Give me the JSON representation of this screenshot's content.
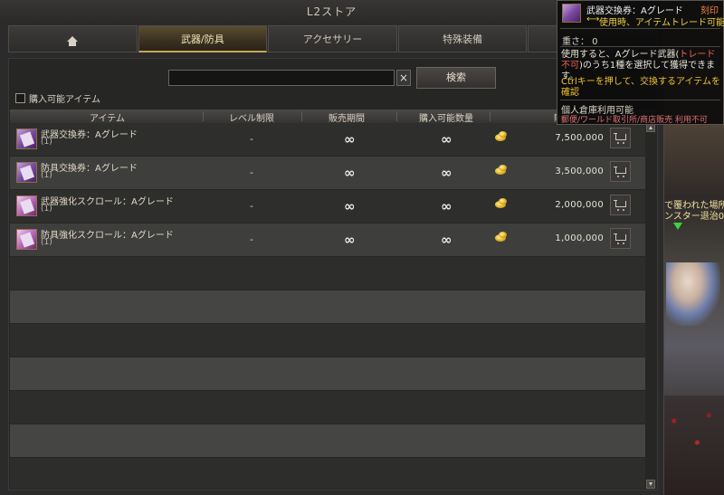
{
  "window": {
    "title": "L2ストア"
  },
  "tabs": [
    {
      "label": "",
      "icon": "home-icon"
    },
    {
      "label": "武器/防具"
    },
    {
      "label": "アクセサリー"
    },
    {
      "label": "特殊装備"
    },
    {
      "label": ""
    }
  ],
  "search": {
    "value": "",
    "placeholder": "",
    "clear_label": "×",
    "button_label": "検索"
  },
  "filter": {
    "purchasable_label": "購入可能アイテム",
    "checked": false
  },
  "columns": {
    "item": "アイテム",
    "level_limit": "レベル制限",
    "sale_period": "販売期間",
    "purchasable_qty": "購入可能数量",
    "price": "販"
  },
  "rows": [
    {
      "name": "武器交換券：Aグレード",
      "qty": "(1)",
      "level": "-",
      "period": "∞",
      "limit": "∞",
      "price": "7,500,000",
      "icon": "weapon-ticket-icon"
    },
    {
      "name": "防具交換券：Aグレード",
      "qty": "(1)",
      "level": "-",
      "period": "∞",
      "limit": "∞",
      "price": "3,500,000",
      "icon": "armor-ticket-icon"
    },
    {
      "name": "武器強化スクロール：Aグレード",
      "qty": "(1)",
      "level": "-",
      "period": "∞",
      "limit": "∞",
      "price": "2,000,000",
      "icon": "weapon-scroll-icon"
    },
    {
      "name": "防具強化スクロール：Aグレード",
      "qty": "(1)",
      "level": "-",
      "period": "∞",
      "limit": "∞",
      "price": "1,000,000",
      "icon": "armor-scroll-icon"
    }
  ],
  "tooltip": {
    "name": "武器交換券：Aグレード",
    "tag": "刻印",
    "arrow": "⟷",
    "trade": "使用時、アイテムトレード可能",
    "weight": "重さ： 0",
    "desc_pre": "使用すると、Aグレード武器(",
    "desc_hl": "トレード不可",
    "desc_post": ")のうち1種を選択して獲得できます。",
    "ctrl": "Ctrlキーを押して、交換するアイテムを確認",
    "storage": "個人倉庫利用可能",
    "restrict": "郵便/ワールド取引所/商店販売 利用不可"
  },
  "game_text": {
    "line1": "で覆われた場所",
    "line2": "ンスター退治0"
  },
  "colors": {
    "accent_gold": "#c9a65a",
    "trade_yellow": "#f0d040",
    "warning_red": "#f06050"
  }
}
